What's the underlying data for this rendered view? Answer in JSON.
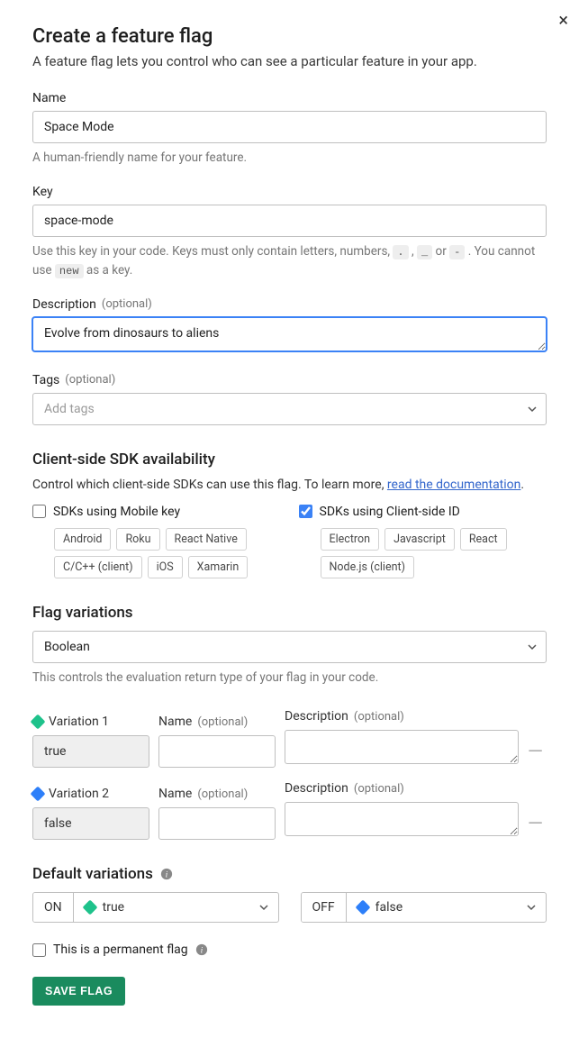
{
  "header": {
    "title": "Create a feature flag",
    "subtitle": "A feature flag lets you control who can see a particular feature in your app."
  },
  "name_field": {
    "label": "Name",
    "value": "Space Mode",
    "hint": "A human-friendly name for your feature."
  },
  "key_field": {
    "label": "Key",
    "value": "space-mode",
    "hint_pre": "Use this key in your code. Keys must only contain letters, numbers, ",
    "code1": ".",
    "hint_mid1": " , ",
    "code2": "_",
    "hint_mid2": " or ",
    "code3": "-",
    "hint_post": " . You cannot use ",
    "code4": "new",
    "hint_tail": " as a key."
  },
  "desc_field": {
    "label": "Description",
    "optional": "(optional)",
    "value": "Evolve from dinosaurs to aliens"
  },
  "tags_field": {
    "label": "Tags",
    "optional": "(optional)",
    "placeholder": "Add tags"
  },
  "sdk": {
    "heading": "Client-side SDK availability",
    "desc": "Control which client-side SDKs can use this flag. To learn more, ",
    "link": "read the documentation",
    "period": ".",
    "mobile": {
      "label": "SDKs using Mobile key",
      "checked": false,
      "items": [
        "Android",
        "Roku",
        "React Native",
        "C/C++ (client)",
        "iOS",
        "Xamarin"
      ]
    },
    "client": {
      "label": "SDKs using Client-side ID",
      "checked": true,
      "items": [
        "Electron",
        "Javascript",
        "React",
        "Node.js (client)"
      ]
    }
  },
  "variations_section": {
    "heading": "Flag variations",
    "type": "Boolean",
    "hint": "This controls the evaluation return type of your flag in your code."
  },
  "variations": [
    {
      "title": "Variation 1",
      "value": "true",
      "diamond": "d-green"
    },
    {
      "title": "Variation 2",
      "value": "false",
      "diamond": "d-blue"
    }
  ],
  "var_labels": {
    "name": "Name",
    "description": "Description",
    "optional": "(optional)"
  },
  "defaults": {
    "heading": "Default variations",
    "on_label": "ON",
    "on_value": "true",
    "on_diamond": "d-green",
    "off_label": "OFF",
    "off_value": "false",
    "off_diamond": "d-blue"
  },
  "permanent": {
    "label": "This is a permanent flag",
    "checked": false
  },
  "save_label": "SAVE FLAG"
}
